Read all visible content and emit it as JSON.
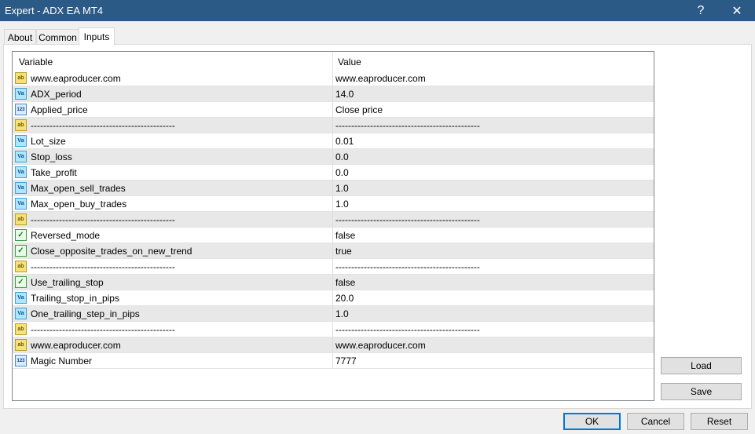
{
  "window": {
    "title": "Expert - ADX EA MT4",
    "help_glyph": "?",
    "close_glyph": "✕"
  },
  "tabs": [
    {
      "label": "About",
      "active": false
    },
    {
      "label": "Common",
      "active": false
    },
    {
      "label": "Inputs",
      "active": true
    }
  ],
  "table": {
    "headers": {
      "variable": "Variable",
      "value": "Value"
    },
    "icon_glyphs": {
      "ab": "ab",
      "va": "Va",
      "n123": "123",
      "bool": "✓"
    },
    "rows": [
      {
        "icon": "ab",
        "variable": "www.eaproducer.com",
        "value": "www.eaproducer.com"
      },
      {
        "icon": "va",
        "variable": "ADX_period",
        "value": "14.0"
      },
      {
        "icon": "n123",
        "variable": "Applied_price",
        "value": "Close price"
      },
      {
        "icon": "ab",
        "variable": "----------------------------------------------",
        "value": "----------------------------------------------"
      },
      {
        "icon": "va",
        "variable": "Lot_size",
        "value": "0.01"
      },
      {
        "icon": "va",
        "variable": "Stop_loss",
        "value": "0.0"
      },
      {
        "icon": "va",
        "variable": "Take_profit",
        "value": "0.0"
      },
      {
        "icon": "va",
        "variable": "Max_open_sell_trades",
        "value": "1.0"
      },
      {
        "icon": "va",
        "variable": "Max_open_buy_trades",
        "value": "1.0"
      },
      {
        "icon": "ab",
        "variable": "----------------------------------------------",
        "value": "----------------------------------------------"
      },
      {
        "icon": "bool",
        "variable": "Reversed_mode",
        "value": "false"
      },
      {
        "icon": "bool",
        "variable": "Close_opposite_trades_on_new_trend",
        "value": "true"
      },
      {
        "icon": "ab",
        "variable": "----------------------------------------------",
        "value": "----------------------------------------------"
      },
      {
        "icon": "bool",
        "variable": "Use_trailing_stop",
        "value": "false"
      },
      {
        "icon": "va",
        "variable": "Trailing_stop_in_pips",
        "value": "20.0"
      },
      {
        "icon": "va",
        "variable": "One_trailing_step_in_pips",
        "value": "1.0"
      },
      {
        "icon": "ab",
        "variable": "----------------------------------------------",
        "value": "----------------------------------------------"
      },
      {
        "icon": "ab",
        "variable": "www.eaproducer.com",
        "value": "www.eaproducer.com"
      },
      {
        "icon": "n123",
        "variable": "Magic Number",
        "value": "7777"
      }
    ]
  },
  "side_buttons": {
    "load": "Load",
    "save": "Save"
  },
  "footer_buttons": {
    "ok": "OK",
    "cancel": "Cancel",
    "reset": "Reset"
  }
}
